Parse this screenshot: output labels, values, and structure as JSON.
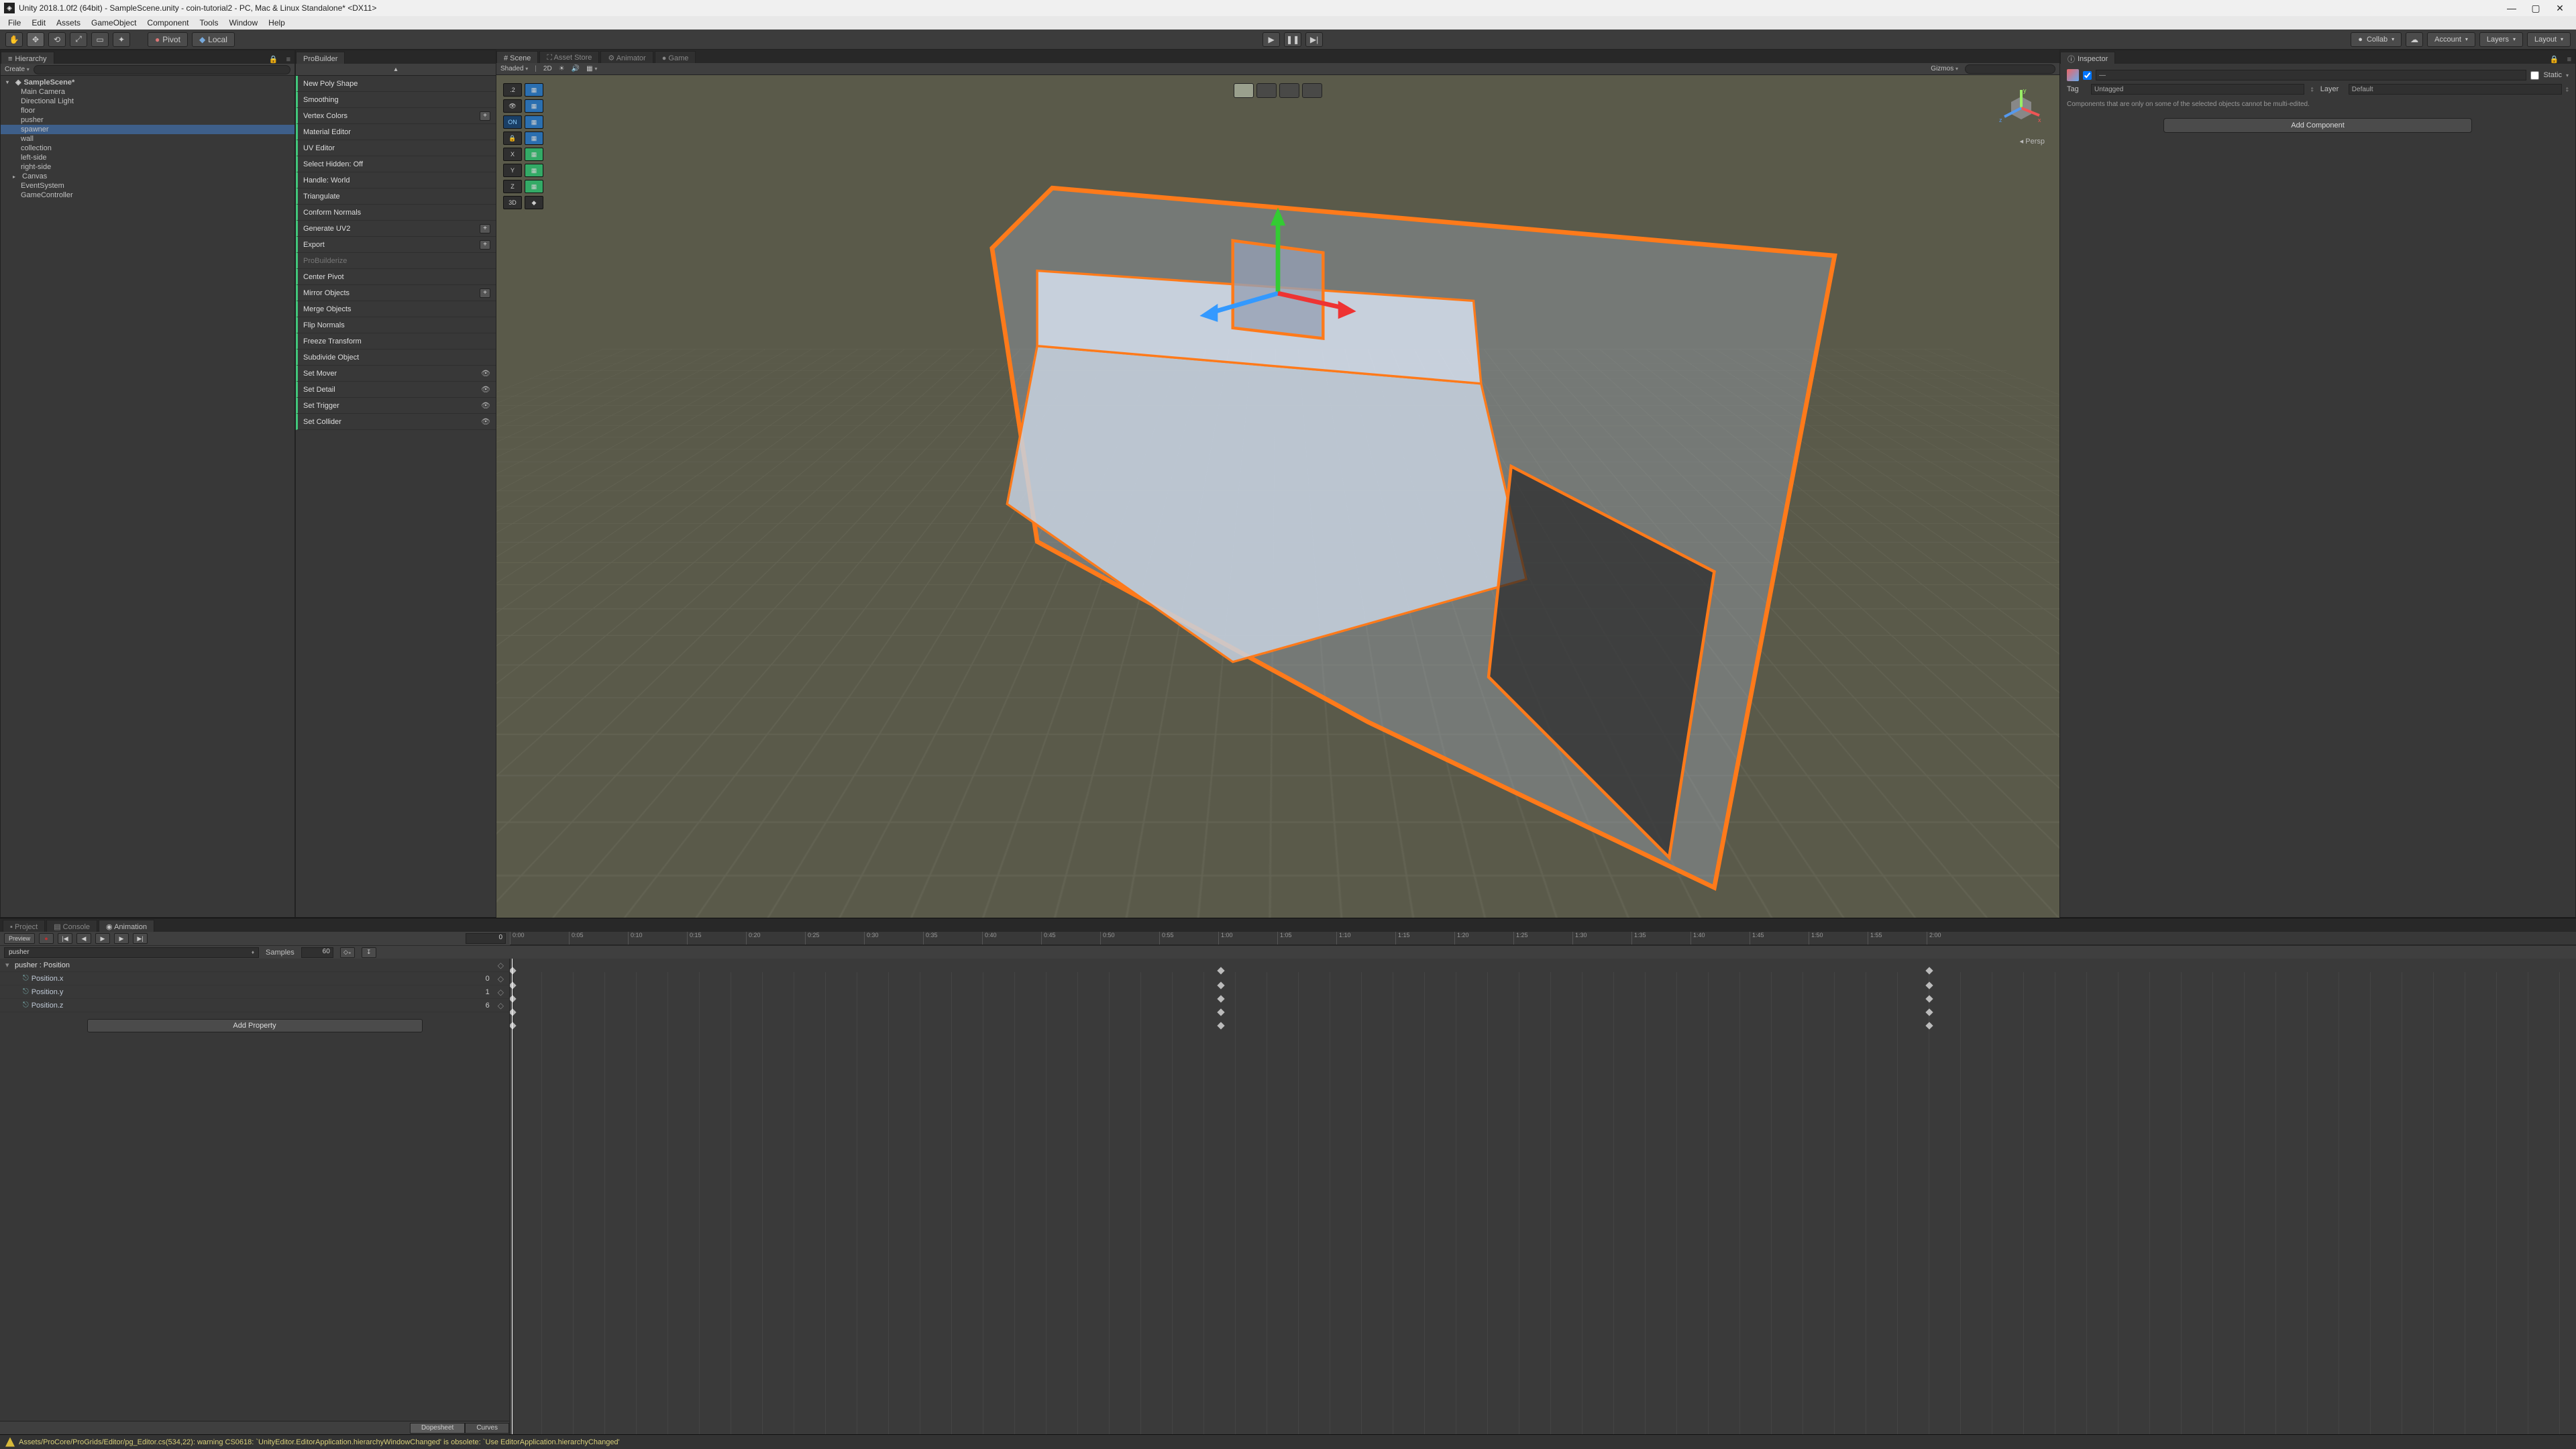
{
  "window": {
    "title": "Unity 2018.1.0f2 (64bit) - SampleScene.unity - coin-tutorial2 - PC, Mac & Linux Standalone* <DX11>",
    "min": "—",
    "max": "▢",
    "close": "✕"
  },
  "menu": [
    "File",
    "Edit",
    "Assets",
    "GameObject",
    "Component",
    "Tools",
    "Window",
    "Help"
  ],
  "toolbar": {
    "pivot": "Pivot",
    "local": "Local",
    "collab": "Collab",
    "account": "Account",
    "layers": "Layers",
    "layout": "Layout"
  },
  "hierarchy": {
    "title": "Hierarchy",
    "create": "Create",
    "scene": "SampleScene*",
    "items": [
      "Main Camera",
      "Directional Light",
      "floor",
      "pusher",
      "spawner",
      "wall",
      "collection",
      "left-side",
      "right-side",
      "Canvas",
      "EventSystem",
      "GameController"
    ],
    "selected": "spawner"
  },
  "probuilder": {
    "title": "ProBuilder",
    "items": [
      {
        "label": "New Poly Shape"
      },
      {
        "label": "Smoothing"
      },
      {
        "label": "Vertex Colors",
        "plus": true
      },
      {
        "label": "Material Editor"
      },
      {
        "label": "UV Editor"
      },
      {
        "label": "Select Hidden: Off"
      },
      {
        "label": "Handle: World"
      },
      {
        "label": "Triangulate"
      },
      {
        "label": "Conform Normals"
      },
      {
        "label": "Generate UV2",
        "plus": true
      },
      {
        "label": "Export",
        "plus": true
      },
      {
        "label": "ProBuilderize",
        "dim": true
      },
      {
        "label": "Center Pivot"
      },
      {
        "label": "Mirror Objects",
        "plus": true
      },
      {
        "label": "Merge Objects"
      },
      {
        "label": "Flip Normals"
      },
      {
        "label": "Freeze Transform"
      },
      {
        "label": "Subdivide Object"
      },
      {
        "label": "Set Mover",
        "eye": true
      },
      {
        "label": "Set Detail",
        "eye": true
      },
      {
        "label": "Set Trigger",
        "eye": true
      },
      {
        "label": "Set Collider",
        "eye": true
      }
    ]
  },
  "centerTabs": [
    {
      "label": "Scene",
      "active": true
    },
    {
      "label": "Asset Store",
      "active": false
    },
    {
      "label": "Animator",
      "active": false
    },
    {
      "label": "Game",
      "active": false
    }
  ],
  "sceneToolbar": {
    "shaded": "Shaded",
    "twod": "2D",
    "gizmos": "Gizmos"
  },
  "sceneOverlay": {
    "persp": "Persp",
    "axes": {
      "x": "x",
      "y": "y",
      "z": "z"
    }
  },
  "sceneLeftGadgets": {
    "val": ".2",
    "on": "ON",
    "x": "X",
    "y": "Y",
    "z": "Z",
    "threeD": "3D"
  },
  "inspector": {
    "title": "Inspector",
    "staticLabel": "Static",
    "tagLabel": "Tag",
    "tagValue": "Untagged",
    "layerLabel": "Layer",
    "layerValue": "Default",
    "note": "Components that are only on some of the selected objects cannot be multi-edited.",
    "addComponent": "Add Component"
  },
  "bottomTabs": [
    {
      "label": "Project",
      "active": false
    },
    {
      "label": "Console",
      "active": false
    },
    {
      "label": "Animation",
      "active": true
    }
  ],
  "animation": {
    "preview": "Preview",
    "frame": "0",
    "clip": "pusher",
    "samplesLabel": "Samples",
    "samples": "60",
    "property": {
      "parent": "pusher : Position",
      "rows": [
        {
          "name": "Position.x",
          "val": "0"
        },
        {
          "name": "Position.y",
          "val": "1"
        },
        {
          "name": "Position.z",
          "val": "6"
        }
      ]
    },
    "addProperty": "Add Property",
    "ticks": [
      "0:00",
      "0:05",
      "0:10",
      "0:15",
      "0:20",
      "0:25",
      "0:30",
      "0:35",
      "0:40",
      "0:45",
      "0:50",
      "0:55",
      "1:00",
      "1:05",
      "1:10",
      "1:15",
      "1:20",
      "1:25",
      "1:30",
      "1:35",
      "1:40",
      "1:45",
      "1:50",
      "1:55",
      "2:00"
    ],
    "modes": {
      "dopesheet": "Dopesheet",
      "curves": "Curves"
    }
  },
  "status": {
    "msg": "Assets/ProCore/ProGrids/Editor/pg_Editor.cs(534,22): warning CS0618: `UnityEditor.EditorApplication.hierarchyWindowChanged' is obsolete: `Use EditorApplication.hierarchyChanged'"
  }
}
